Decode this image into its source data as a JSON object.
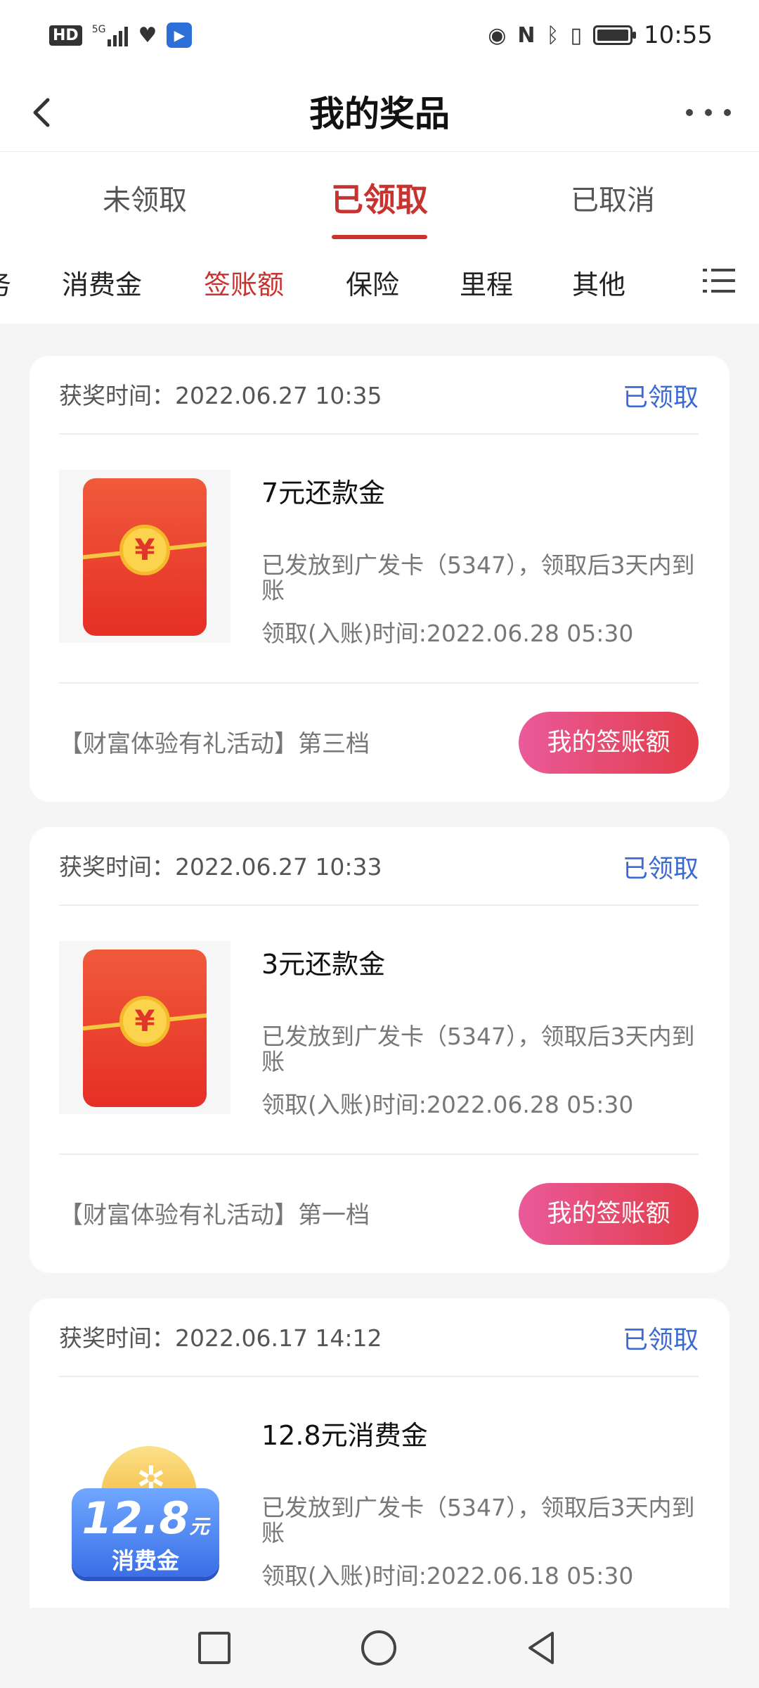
{
  "statusbar": {
    "hd": "HD",
    "net": "5G",
    "time": "10:55",
    "icons": [
      "hd-icon",
      "signal-icon",
      "health-icon",
      "app-notification-icon",
      "eye-icon",
      "nfc-icon",
      "bluetooth-icon",
      "vibrate-icon",
      "battery-icon"
    ]
  },
  "navbar": {
    "title": "我的奖品",
    "back_icon": "chevron-left-icon",
    "more_icon": "more-dots-icon"
  },
  "tabs": [
    {
      "label": "未领取",
      "active": false
    },
    {
      "label": "已领取",
      "active": true
    },
    {
      "label": "已取消",
      "active": false
    }
  ],
  "categories": {
    "partial_left": "务",
    "items": [
      "消费金",
      "签账额",
      "保险",
      "里程",
      "其他"
    ],
    "active": "签账额",
    "menu_icon": "list-menu-icon"
  },
  "colors": {
    "accent_red": "#c8322f",
    "status_blue": "#3c6ad4",
    "button_gradient_start": "#ea5a9a",
    "button_gradient_end": "#e23c46"
  },
  "cards": [
    {
      "award_time": "获奖时间：2022.06.27 10:35",
      "status": "已领取",
      "image": "red-envelope",
      "prize_name": "7元还款金",
      "desc": "已发放到广发卡（5347），领取后3天内到账",
      "received": "领取(入账)时间:2022.06.28 05:30",
      "activity": "【财富体验有礼活动】第三档",
      "button": "我的签账额"
    },
    {
      "award_time": "获奖时间：2022.06.27 10:33",
      "status": "已领取",
      "image": "red-envelope",
      "prize_name": "3元还款金",
      "desc": "已发放到广发卡（5347），领取后3天内到账",
      "received": "领取(入账)时间:2022.06.28 05:30",
      "activity": "【财富体验有礼活动】第一档",
      "button": "我的签账额"
    },
    {
      "award_time": "获奖时间：2022.06.17 14:12",
      "status": "已领取",
      "image": "consumption-voucher",
      "voucher_amount": "12.8",
      "voucher_unit": "元",
      "voucher_label": "消费金",
      "prize_name": "12.8元消费金",
      "desc": "已发放到广发卡（5347），领取后3天内到账",
      "received": "领取(入账)时间:2022.06.18 05:30"
    }
  ],
  "bottom_nav": [
    "recent-apps-icon",
    "home-icon",
    "back-icon"
  ]
}
